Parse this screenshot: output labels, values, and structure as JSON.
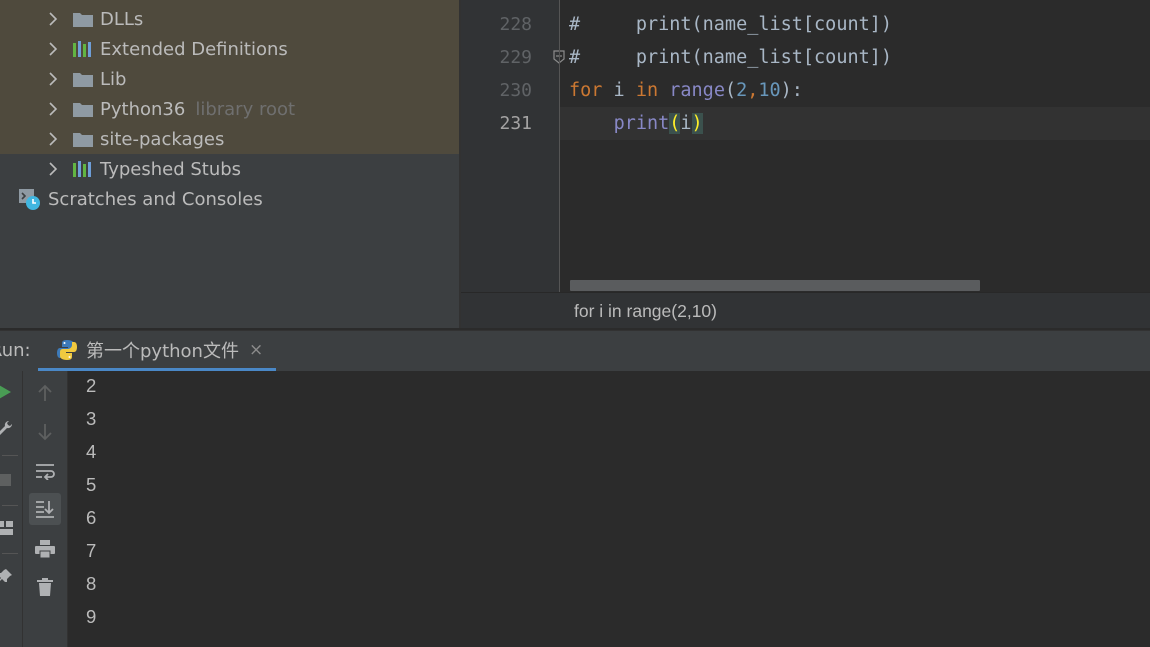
{
  "project_tree": {
    "items": [
      {
        "label": "DLLs",
        "icon": "folder-icon"
      },
      {
        "label": "Extended Definitions",
        "icon": "library-icon"
      },
      {
        "label": "Lib",
        "icon": "folder-icon"
      },
      {
        "label": "Python36",
        "icon": "folder-icon",
        "suffix": "library root"
      },
      {
        "label": "site-packages",
        "icon": "folder-icon"
      },
      {
        "label": "Typeshed Stubs",
        "icon": "library-icon"
      }
    ],
    "scratches": {
      "label": "Scratches and Consoles",
      "icon": "scratches-icon"
    }
  },
  "editor": {
    "lines": [
      {
        "number": "228",
        "text": "#     print(name_list[count])"
      },
      {
        "number": "229",
        "text": "#     print(name_list[count])"
      },
      {
        "number": "230",
        "text": "for i in range(2,10):"
      },
      {
        "number": "231",
        "text": "    print(i)"
      }
    ],
    "tokens": {
      "comment_prefix": "#",
      "comment_body": "     print(name_list[count])",
      "for": "for",
      "i": " i ",
      "in": "in",
      "range": "range",
      "open": "(",
      "two": "2",
      "comma": ",",
      "ten": "10",
      "close_colon": "):",
      "indent": "    ",
      "print": "print",
      "paren_open": "(",
      "var": "i",
      "paren_close": ")"
    },
    "breadcrumb": "for i in range(2,10)"
  },
  "run": {
    "label": "Run:",
    "tab_title": "第一个python文件",
    "close_symbol": "×",
    "output": [
      "2",
      "3",
      "4",
      "5",
      "6",
      "7",
      "8",
      "9"
    ]
  },
  "colors": {
    "keyword": "#cc7832",
    "builtin": "#8888c6",
    "number": "#6897bb",
    "brace_match": "#ffef28",
    "run_green": "#499c54",
    "tab_underline": "#4a88c7"
  }
}
